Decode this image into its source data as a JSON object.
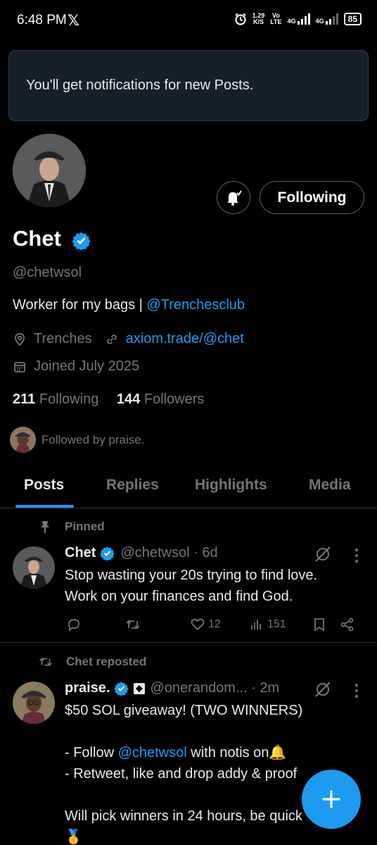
{
  "status_bar": {
    "time": "6:48 PM",
    "x_logo": "𝕏",
    "net_speed_top": "1.29",
    "net_speed_bottom": "K/S",
    "vo_top": "Vo",
    "vo_bottom": "LTE",
    "net1": "4G",
    "net2": "4G",
    "battery": "85"
  },
  "toast": {
    "text": "You'll get notifications for new Posts."
  },
  "profile": {
    "following_button": "Following",
    "name": "Chet",
    "handle": "@chetwsol",
    "bio_text": "Worker for my bags | ",
    "bio_link": "@Trenchesclub",
    "location": "Trenches",
    "website": "axiom.trade/@chet",
    "joined": "Joined July 2025",
    "following_count": "211",
    "following_label": "Following",
    "followers_count": "144",
    "followers_label": "Followers",
    "followed_by": "Followed by praise."
  },
  "tabs": [
    "Posts",
    "Replies",
    "Highlights",
    "Media"
  ],
  "posts": [
    {
      "context": "Pinned",
      "name": "Chet",
      "handle_time": "@chetwsol · 6d",
      "text": "Stop wasting your 20s trying to find love.\nWork on your finances and find God.",
      "likes": "12",
      "views": "151"
    },
    {
      "context": "Chet reposted",
      "name": "praise.",
      "handle_time": "@onerandom... · 2m",
      "text_line1": "$50 SOL giveaway! (TWO WINNERS)",
      "text_line2_a": "- Follow ",
      "text_line2_link": "@chetwsol",
      "text_line2_b": " with notis on🔔",
      "text_line3": "- Retweet, like and drop addy & proof",
      "text_line4": "Will pick winners in 24 hours, be quick",
      "text_line5": "🥇"
    }
  ],
  "colors": {
    "accent": "#1d9bf0",
    "background": "#000000",
    "muted": "#71767b",
    "toast_bg": "#15202b"
  }
}
